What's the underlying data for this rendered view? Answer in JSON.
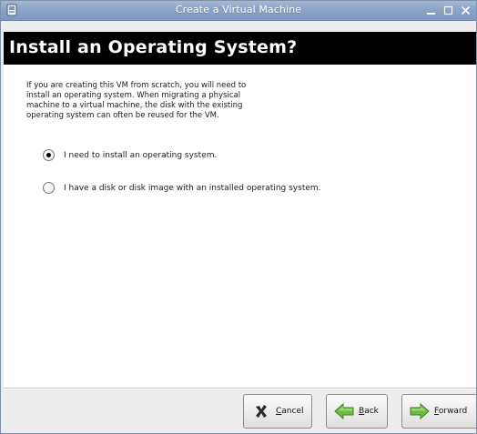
{
  "window": {
    "title": "Create a Virtual Machine",
    "controls": [
      "minimize-icon",
      "maximize-icon",
      "close-icon"
    ]
  },
  "banner": {
    "title": "Install an Operating System?"
  },
  "content": {
    "intro_text": "If you are creating this VM from scratch, you will need to\ninstall an operating system.  When migrating a physical\nmachine to a virtual machine, the disk with the existing\noperating system can often be reused for the VM.",
    "options": [
      {
        "label": "I need to install an operating system.",
        "selected": true
      },
      {
        "label": "I have a disk or disk image with an installed operating system.",
        "selected": false
      }
    ]
  },
  "buttons": {
    "cancel": {
      "mnemonic": "C",
      "rest": "ancel",
      "icon": "cancel-x-icon"
    },
    "back": {
      "mnemonic": "B",
      "rest": "ack",
      "icon": "back-arrow-icon"
    },
    "forward": {
      "mnemonic": "F",
      "rest": "orward",
      "icon": "forward-arrow-icon"
    }
  },
  "colors": {
    "titlebar": "#8aa3c7",
    "banner_bg": "#000000",
    "banner_text": "#ffffff",
    "arrow_green": "#5fae3a"
  }
}
